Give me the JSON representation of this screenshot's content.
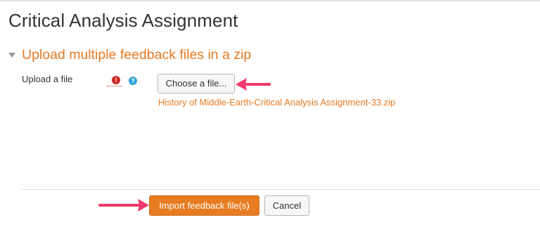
{
  "page": {
    "title": "Critical Analysis Assignment"
  },
  "section": {
    "title": "Upload multiple feedback files in a zip",
    "expanded": true
  },
  "form": {
    "field_label": "Upload a file",
    "required_icon": "exclamation-icon",
    "help_icon": "question-icon",
    "choose_button_label": "Choose a file...",
    "selected_file": "History of Middle-Earth-Critical Analysis Assignment-33.zip"
  },
  "actions": {
    "import_label": "Import feedback file(s)",
    "cancel_label": "Cancel"
  },
  "footnote": "",
  "colors": {
    "accent": "#e57923",
    "import_button": "#e77c20",
    "required": "#cf2a27",
    "help": "#31a3d9",
    "annotation_arrow": "#ee3b6a"
  }
}
